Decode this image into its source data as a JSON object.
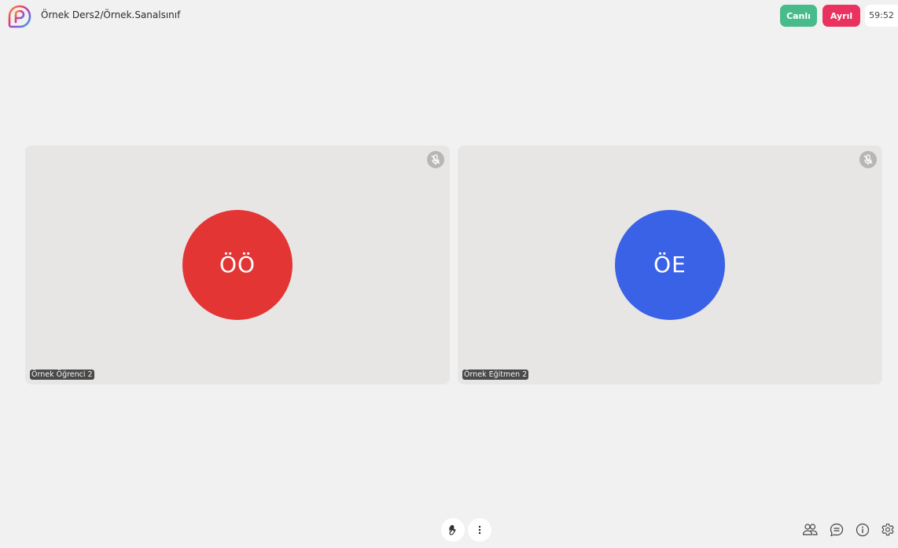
{
  "header": {
    "title": "Örnek Ders2/Örnek.Sanalsınıf",
    "logo_icon": "app-logo-icon",
    "live_label": "Canlı",
    "leave_label": "Ayrıl",
    "timer": "59:52"
  },
  "colors": {
    "live": "#48bb8b",
    "leave": "#e9325f",
    "avatar_student": "#e33534",
    "avatar_teacher": "#3a62e6",
    "tile_bg": "#e8e6e5",
    "page_bg": "#f1f1f1"
  },
  "participants": [
    {
      "initials": "ÖÖ",
      "name": "Örnek Öğrenci 2",
      "mic_icon": "mic-off-icon"
    },
    {
      "initials": "ÖE",
      "name": "Örnek Eğitmen 2",
      "mic_icon": "mic-off-icon"
    }
  ],
  "controls": {
    "center": [
      "raise-hand-icon",
      "more-vertical-icon"
    ],
    "right": [
      "participants-icon",
      "chat-icon",
      "info-icon",
      "settings-icon"
    ]
  }
}
